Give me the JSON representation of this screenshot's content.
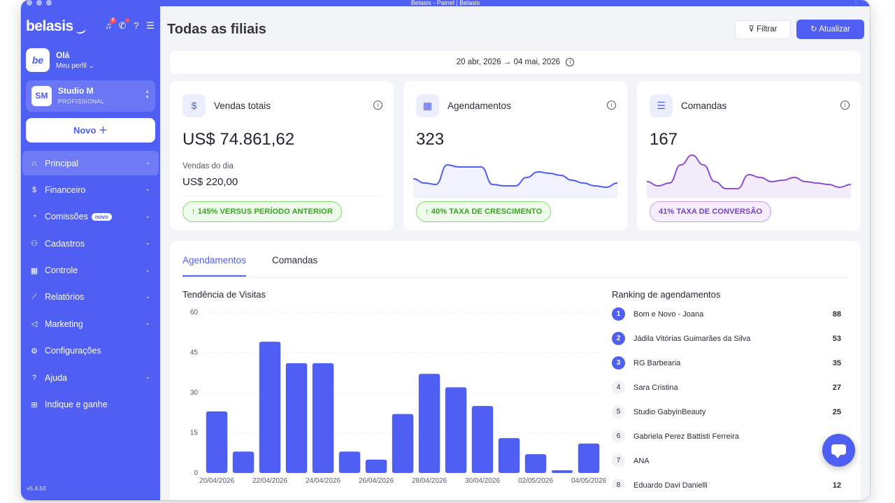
{
  "window": {
    "title": "Belasis - Painel | Belasis"
  },
  "sidebar": {
    "logo": "belasis",
    "notification_count": "2",
    "profile": {
      "avatar": "be",
      "greeting": "Olá",
      "link": "Meu perfil ⌄"
    },
    "studio": {
      "initials": "SM",
      "name": "Studio M",
      "plan": "PROFISSIONAL"
    },
    "new_button": "Novo ＋",
    "items": [
      {
        "label": "Principal",
        "icon": "⌂",
        "icon_name": "home-icon",
        "chevron": true,
        "active": true
      },
      {
        "label": "Financeiro",
        "icon": "$",
        "icon_name": "dollar-icon",
        "chevron": true
      },
      {
        "label": "Comissões",
        "icon": "◔",
        "icon_name": "pie-icon",
        "chevron": true,
        "tag": "novo"
      },
      {
        "label": "Cadastros",
        "icon": "⚇",
        "icon_name": "users-icon",
        "chevron": true
      },
      {
        "label": "Controle",
        "icon": "▦",
        "icon_name": "grid-icon",
        "chevron": true
      },
      {
        "label": "Relatórios",
        "icon": "⟋",
        "icon_name": "chart-icon",
        "chevron": true
      },
      {
        "label": "Marketing",
        "icon": "◁",
        "icon_name": "megaphone-icon",
        "chevron": true
      },
      {
        "label": "Configurações",
        "icon": "⚙",
        "icon_name": "gear-icon",
        "chevron": false
      },
      {
        "label": "Ajuda",
        "icon": "?",
        "icon_name": "help-icon",
        "chevron": true
      },
      {
        "label": "Indique e ganhe",
        "icon": "⊞",
        "icon_name": "gift-icon",
        "chevron": false
      }
    ],
    "version": "v5.4.50"
  },
  "header": {
    "title": "Todas as filiais",
    "filter_button": "Filtrar",
    "refresh_button": "Atualizar",
    "date_range": "20 abr, 2026 → 04 mai, 2026"
  },
  "cards": {
    "sales": {
      "title": "Vendas totais",
      "value": "US$ 74.861,62",
      "sub_label": "Vendas do dia",
      "sub_value": "US$ 220,00",
      "pill": "↑ 145% VERSUS PERÍODO ANTERIOR"
    },
    "appointments": {
      "title": "Agendamentos",
      "value": "323",
      "pill": "↑ 40% TAXA DE CRESCIMENTO",
      "spark": [
        28,
        22,
        20,
        48,
        45,
        45,
        45,
        20,
        18,
        18,
        30,
        38,
        36,
        33,
        26,
        22,
        18,
        16,
        22
      ]
    },
    "orders": {
      "title": "Comandas",
      "value": "167",
      "pill": "41% TAXA DE CONVERSÃO",
      "spark": [
        24,
        18,
        22,
        48,
        62,
        48,
        24,
        14,
        14,
        34,
        30,
        24,
        26,
        30,
        24,
        22,
        20,
        16,
        20
      ]
    }
  },
  "tabs": [
    "Agendamentos",
    "Comandas"
  ],
  "chart_data": {
    "type": "bar",
    "title": "Tendência de Visitas",
    "categories": [
      "20/04/2026",
      "21/04/2026",
      "22/04/2026",
      "23/04/2026",
      "24/04/2026",
      "25/04/2026",
      "26/04/2026",
      "27/04/2026",
      "28/04/2026",
      "29/04/2026",
      "30/04/2026",
      "01/05/2026",
      "02/05/2026",
      "03/05/2026",
      "04/05/2026"
    ],
    "tick_labels": [
      "20/04/2026",
      "22/04/2026",
      "24/04/2026",
      "26/04/2026",
      "28/04/2026",
      "30/04/2026",
      "02/05/2026",
      "04/05/2026"
    ],
    "values": [
      23,
      8,
      49,
      41,
      41,
      8,
      5,
      22,
      37,
      32,
      25,
      13,
      7,
      1,
      11
    ],
    "ylim": [
      0,
      60
    ],
    "yticks": [
      0,
      15,
      30,
      45,
      60
    ],
    "color": "#4f5ef3",
    "grid": true
  },
  "ranking": {
    "title": "Ranking de agendamentos",
    "items": [
      {
        "rank": "1",
        "name": "Bom e Novo - Joana",
        "value": "88"
      },
      {
        "rank": "2",
        "name": "Jádila Vitórias Guimarães da Silva",
        "value": "53"
      },
      {
        "rank": "3",
        "name": "RG Barbearia",
        "value": "35"
      },
      {
        "rank": "4",
        "name": "Sara Cristina",
        "value": "27"
      },
      {
        "rank": "5",
        "name": "Studio GabyinBeauty",
        "value": "25"
      },
      {
        "rank": "6",
        "name": "Gabriela Perez Battisti Ferreira",
        "value": ""
      },
      {
        "rank": "7",
        "name": "ANA",
        "value": ""
      },
      {
        "rank": "8",
        "name": "Eduardo Davi Danielli",
        "value": "12"
      }
    ]
  },
  "colors": {
    "accent": "#4f5ef3",
    "success": "#35a51c",
    "purple": "#7a3ccc"
  }
}
